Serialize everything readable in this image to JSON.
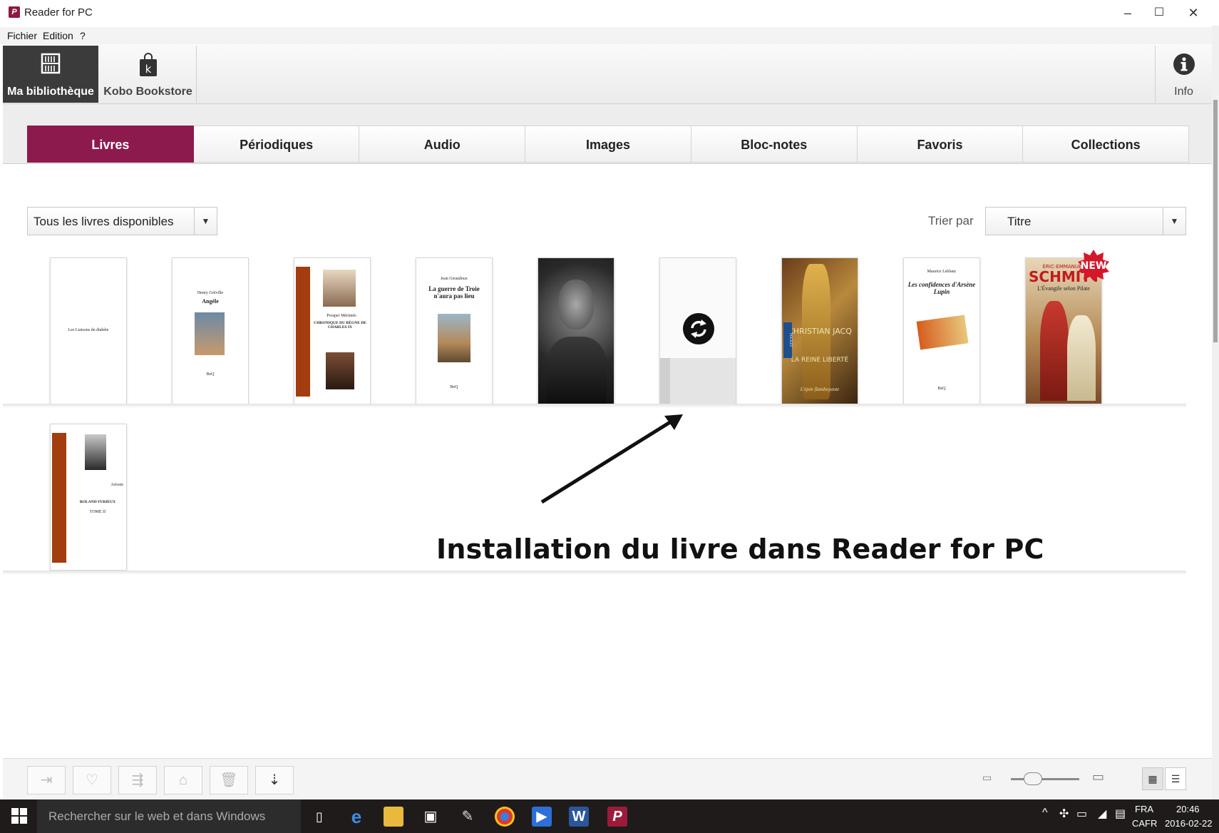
{
  "window": {
    "title": "Reader for PC",
    "logo_letter": "P",
    "minimize": "–",
    "maximize": "☐",
    "close": "✕"
  },
  "menu": [
    "Fichier",
    "Edition",
    "?"
  ],
  "toolbar": {
    "library": "Ma bibliothèque",
    "store": "Kobo Bookstore",
    "store_letter": "k",
    "info": "Info"
  },
  "tabs": [
    "Livres",
    "Périodiques",
    "Audio",
    "Images",
    "Bloc-notes",
    "Favoris",
    "Collections"
  ],
  "active_tab": 0,
  "filter": {
    "value": "Tous les livres disponibles",
    "arrow": "▼"
  },
  "sort": {
    "label": "Trier par",
    "value": "Titre",
    "arrow": "▼"
  },
  "books": {
    "b1": {
      "title": "Les Liaisons du diabète"
    },
    "b2": {
      "author": "Henry Gréville",
      "title": "Angèle",
      "publisher": "BeQ"
    },
    "b3": {
      "author": "Prosper Mérimée",
      "title": "CHRONIQUE DU RÈGNE DE CHARLES IX"
    },
    "b4": {
      "author": "Jean Giraudoux",
      "title": "La guerre de Troie n'aura pas lieu",
      "publisher": "BeQ"
    },
    "b7": {
      "author": "CHRISTIAN JACQ",
      "title": "LA REINE LIBERTÉ",
      "subtitle": "L'épée flamboyante",
      "spine": "POCKET"
    },
    "b8": {
      "author": "Maurice Leblanc",
      "title": "Les confidences d'Arsène Lupin",
      "publisher": "BeQ"
    },
    "b9": {
      "author": "ÉRIC-EMMANUEL",
      "name": "SCHMITT",
      "title": "L'Évangile selon Pilate",
      "badge": "NEW"
    },
    "b10": {
      "author": "Arioste",
      "title": "ROLAND FURIEUX",
      "tome": "TOME II"
    }
  },
  "caption": "Installation du livre dans Reader for PC",
  "taskbar": {
    "search_placeholder": "Rechercher sur le web et dans Windows",
    "lang": "FRA",
    "region": "CAFR",
    "time": "20:46",
    "date": "2016-02-22"
  },
  "colors": {
    "accent": "#8d1a4d",
    "dark_toolbar": "#3b3b3b",
    "taskbar": "#1f1b1b"
  }
}
